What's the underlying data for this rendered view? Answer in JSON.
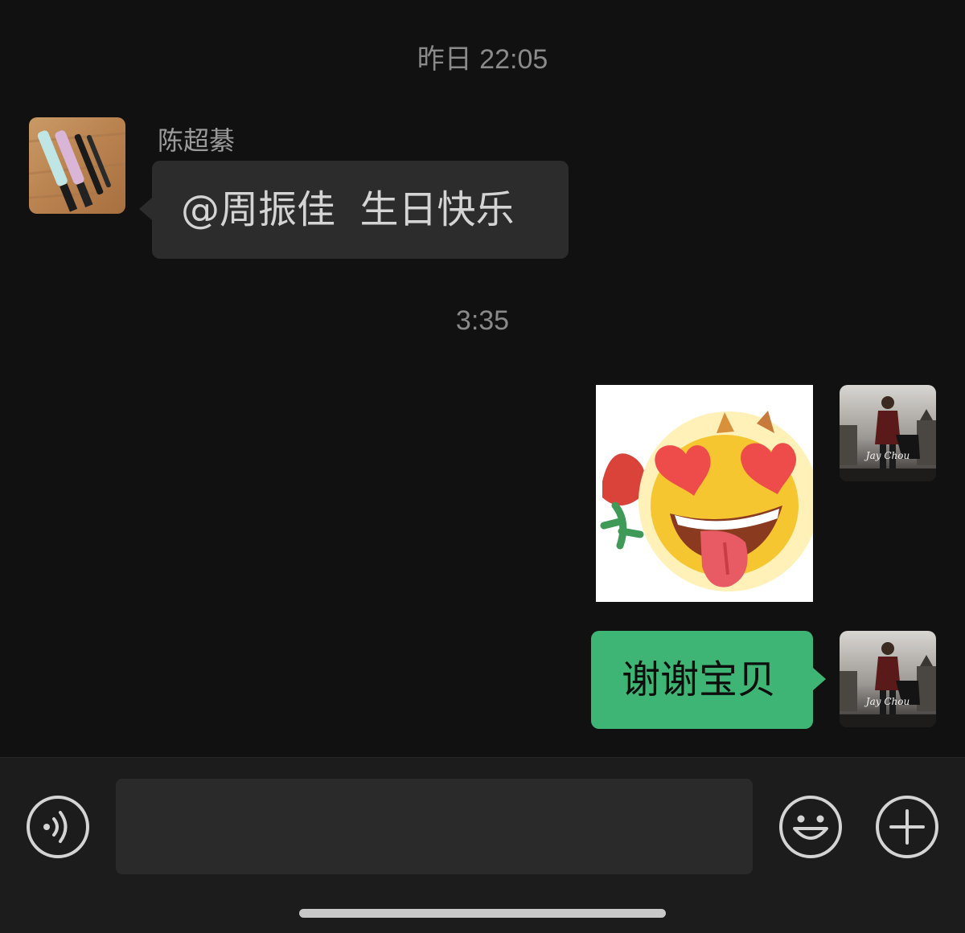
{
  "conversation": {
    "timestamps": [
      "昨日 22:05",
      "3:35"
    ],
    "messages": [
      {
        "direction": "incoming",
        "sender": "陈超綦",
        "text": "@周振佳  生日快乐",
        "avatar": "light-sticks-photo"
      },
      {
        "direction": "outgoing",
        "type": "sticker",
        "sticker": "heart-eyes-rose-emoji",
        "avatar": "album-cover-photo"
      },
      {
        "direction": "outgoing",
        "text": "谢谢宝贝",
        "avatar": "album-cover-photo"
      }
    ]
  },
  "input_bar": {
    "voice_icon": "voice-icon",
    "text_value": "",
    "emoji_icon": "emoji-icon",
    "plus_icon": "plus-icon"
  },
  "colors": {
    "background": "#111111",
    "incoming_bubble": "#2c2c2c",
    "outgoing_bubble": "#3eb575",
    "input_bar": "#1c1c1c",
    "timestamp_text": "#8a8a8a"
  }
}
